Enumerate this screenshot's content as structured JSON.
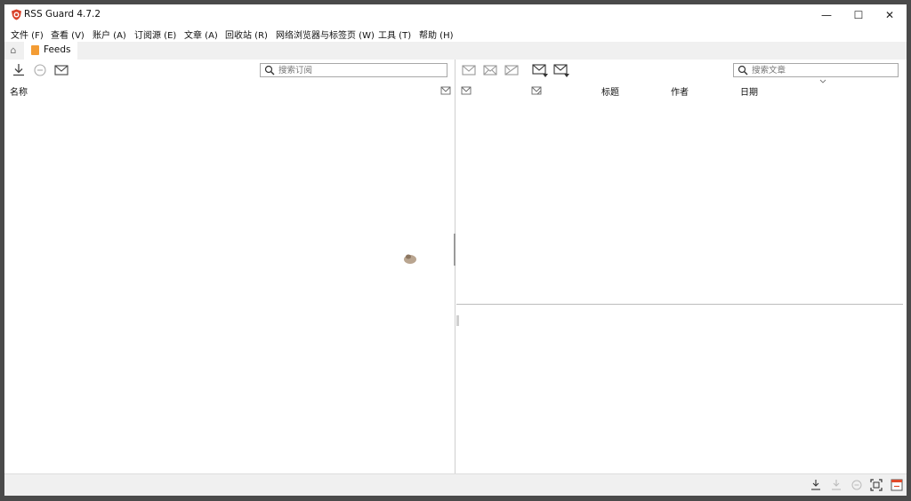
{
  "window": {
    "title": "RSS Guard 4.7.2",
    "controls": {
      "minimize": "—",
      "maximize": "☐",
      "close": "✕"
    }
  },
  "menu": [
    "文件 (F)",
    "查看 (V)",
    "账户 (A)",
    "订阅源 (E)",
    "文章 (A)",
    "回收站 (R)",
    "网络浏览器与标签页 (W)",
    "工具 (T)",
    "帮助 (H)"
  ],
  "tabs": {
    "feeds_label": "Feeds"
  },
  "feeds_panel": {
    "search_placeholder": "搜索订阅",
    "columns": {
      "name": "名称"
    },
    "toolbar_icons": [
      "download-icon",
      "stop-icon",
      "mark-read-icon"
    ]
  },
  "articles_panel": {
    "search_placeholder": "搜索文章",
    "columns": {
      "title": "标题",
      "author": "作者",
      "date": "日期"
    },
    "toolbar_icons": [
      "mark-read-icon",
      "mark-unread-icon",
      "delete-icon",
      "previous-unread-icon",
      "next-unread-icon"
    ]
  },
  "statusbar_icons": [
    "download-icon",
    "download-disabled-icon",
    "stop-icon",
    "fullscreen-icon",
    "close-tab-icon"
  ],
  "colors": {
    "accent": "#e04a2a",
    "tab_icon": "#f39c34",
    "chrome": "#f0f0f0"
  }
}
